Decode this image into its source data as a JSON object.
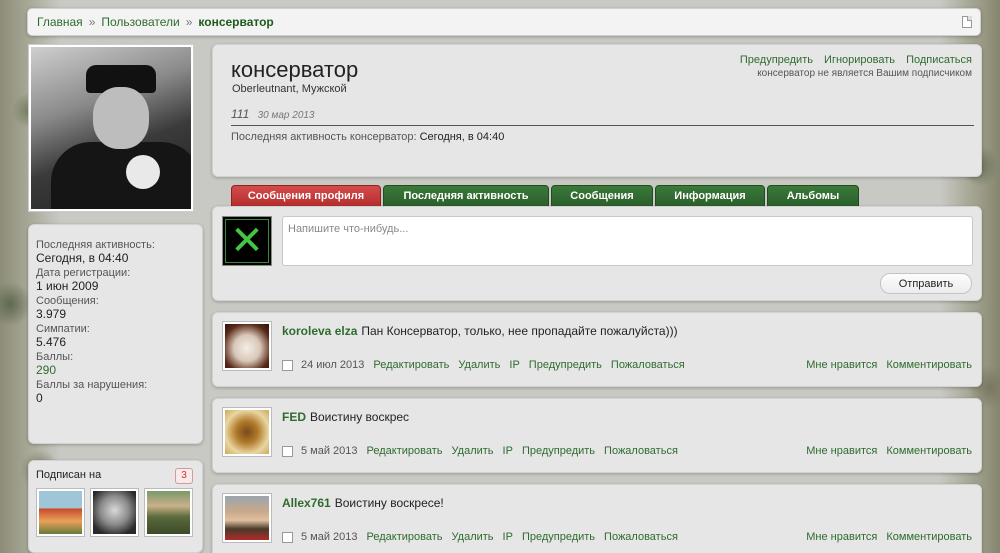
{
  "breadcrumb": {
    "items": [
      "Главная",
      "Пользователи"
    ],
    "separator": "»",
    "current": "консерватор"
  },
  "sidebar": {
    "stats": [
      {
        "label": "Последняя активность:",
        "value": "Сегодня, в 04:40"
      },
      {
        "label": "Дата регистрации:",
        "value": "1 июн 2009"
      },
      {
        "label": "Сообщения:",
        "value": "3.979"
      },
      {
        "label": "Симпатии:",
        "value": "5.476"
      },
      {
        "label": "Баллы:",
        "value": "290"
      },
      {
        "label": "Баллы за нарушения:",
        "value": "0"
      }
    ],
    "following": {
      "title": "Подписан на",
      "count": "3"
    }
  },
  "profile": {
    "username": "консерватор",
    "user_title": "Oberleutnant, Мужской",
    "status_text": "111",
    "status_date": "30 мар 2013",
    "activity_label": "Последняя активность консерватор:",
    "activity_value": "Сегодня, в 04:40",
    "actions": [
      "Предупредить",
      "Игнорировать",
      "Подписаться"
    ],
    "follow_note": "консерватор не является Вашим подписчиком"
  },
  "tabs": [
    {
      "label": "Сообщения профиля",
      "active": true
    },
    {
      "label": "Последняя активность",
      "active": false
    },
    {
      "label": "Сообщения",
      "active": false
    },
    {
      "label": "Информация",
      "active": false
    },
    {
      "label": "Альбомы",
      "active": false
    }
  ],
  "composer": {
    "placeholder": "Напишите что-нибудь...",
    "submit_label": "Отправить"
  },
  "post_actions": {
    "edit": "Редактировать",
    "delete": "Удалить",
    "ip": "IP",
    "warn": "Предупредить",
    "report": "Пожаловаться",
    "like": "Мне нравится",
    "comment": "Комментировать"
  },
  "posts": [
    {
      "author": "koroleva elza",
      "text": "Пан Консерватор, только, нее пропадайте пожалуйста)))",
      "date": "24 июл 2013"
    },
    {
      "author": "FED",
      "text": "Воистину воскрес",
      "date": "5 май 2013"
    },
    {
      "author": "Allex761",
      "text": "Воистину воскресе!",
      "date": "5 май 2013"
    }
  ],
  "colors": {
    "accent_green": "#2f6b2f",
    "tab_green": "#2b5f2b",
    "tab_active_red": "#c03a3a",
    "panel_bg": "#e6e6e6"
  }
}
